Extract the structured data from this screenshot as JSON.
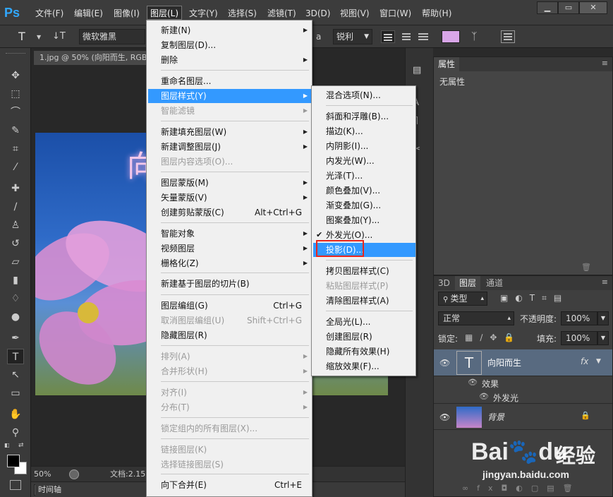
{
  "menubar": {
    "logo": "Ps",
    "items": [
      "文件(F)",
      "编辑(E)",
      "图像(I)",
      "图层(L)",
      "文字(Y)",
      "选择(S)",
      "滤镜(T)",
      "3D(D)",
      "视图(V)",
      "窗口(W)",
      "帮助(H)"
    ]
  },
  "window_controls": {
    "minimize": "▁",
    "restore": "▭",
    "close": "✕"
  },
  "options_bar": {
    "tool_glyph": "T",
    "font_name": "微软雅黑",
    "aa_label": "a",
    "antialias": "锐利",
    "swatch_color": "#d9a6e8"
  },
  "document": {
    "tab_title": "1.jpg @ 50% (向阳而生, RGB",
    "zoom": "50%",
    "doc_info": "文档:2.15",
    "canvas_text": "向"
  },
  "timeline_tab": "时间轴",
  "properties_panel": {
    "tab": "属性",
    "content": "无属性"
  },
  "layers_panel": {
    "tabs": [
      "3D",
      "图层",
      "通道"
    ],
    "filter": "类型",
    "blend_mode": "正常",
    "opacity_label": "不透明度:",
    "opacity": "100%",
    "lock_label": "锁定:",
    "fill_label": "填充:",
    "fill": "100%",
    "layers": [
      {
        "name": "向阳而生",
        "fx": "fx",
        "thumb": "T"
      },
      {
        "name": "背景"
      }
    ],
    "effects_label": "效果",
    "effect_item": "外发光"
  },
  "layer_menu": {
    "items": [
      {
        "label": "新建(N)",
        "arrow": "▶",
        "disabled": false
      },
      {
        "label": "复制图层(D)...",
        "disabled": false
      },
      {
        "label": "删除",
        "arrow": "▶",
        "disabled": false
      },
      {
        "label": "重命名图层...",
        "disabled": false
      },
      {
        "label": "图层样式(Y)",
        "arrow": "▶",
        "disabled": false,
        "highlight": true
      },
      {
        "label": "智能滤镜",
        "arrow": "▶",
        "disabled": true
      },
      {
        "label": "新建填充图层(W)",
        "arrow": "▶",
        "disabled": false
      },
      {
        "label": "新建调整图层(J)",
        "arrow": "▶",
        "disabled": false
      },
      {
        "label": "图层内容选项(O)...",
        "disabled": true
      },
      {
        "label": "图层蒙版(M)",
        "arrow": "▶",
        "disabled": false
      },
      {
        "label": "矢量蒙版(V)",
        "arrow": "▶",
        "disabled": false
      },
      {
        "label": "创建剪贴蒙版(C)",
        "shortcut": "Alt+Ctrl+G",
        "disabled": false
      },
      {
        "label": "智能对象",
        "arrow": "▶",
        "disabled": false
      },
      {
        "label": "视频图层",
        "arrow": "▶",
        "disabled": false
      },
      {
        "label": "栅格化(Z)",
        "arrow": "▶",
        "disabled": false
      },
      {
        "label": "新建基于图层的切片(B)",
        "disabled": false
      },
      {
        "label": "图层编组(G)",
        "shortcut": "Ctrl+G",
        "disabled": false
      },
      {
        "label": "取消图层编组(U)",
        "shortcut": "Shift+Ctrl+G",
        "disabled": true
      },
      {
        "label": "隐藏图层(R)",
        "disabled": false
      },
      {
        "label": "排列(A)",
        "arrow": "▶",
        "disabled": true
      },
      {
        "label": "合并形状(H)",
        "arrow": "▶",
        "disabled": true
      },
      {
        "label": "对齐(I)",
        "arrow": "▶",
        "disabled": true
      },
      {
        "label": "分布(T)",
        "arrow": "▶",
        "disabled": true
      },
      {
        "label": "锁定组内的所有图层(X)...",
        "disabled": true
      },
      {
        "label": "链接图层(K)",
        "disabled": true
      },
      {
        "label": "选择链接图层(S)",
        "disabled": true
      },
      {
        "label": "向下合并(E)",
        "shortcut": "Ctrl+E",
        "disabled": false
      }
    ]
  },
  "style_submenu": {
    "items": [
      {
        "label": "混合选项(N)...",
        "disabled": false
      },
      {
        "label": "斜面和浮雕(B)...",
        "disabled": false
      },
      {
        "label": "描边(K)...",
        "disabled": false
      },
      {
        "label": "内阴影(I)...",
        "disabled": false
      },
      {
        "label": "内发光(W)...",
        "disabled": false
      },
      {
        "label": "光泽(T)...",
        "disabled": false
      },
      {
        "label": "颜色叠加(V)...",
        "disabled": false
      },
      {
        "label": "渐变叠加(G)...",
        "disabled": false
      },
      {
        "label": "图案叠加(Y)...",
        "disabled": false
      },
      {
        "label": "外发光(O)...",
        "disabled": false,
        "checked": true
      },
      {
        "label": "投影(D)...",
        "disabled": false,
        "highlight": true
      },
      {
        "label": "拷贝图层样式(C)",
        "disabled": false
      },
      {
        "label": "粘贴图层样式(P)",
        "disabled": true
      },
      {
        "label": "清除图层样式(A)",
        "disabled": false
      },
      {
        "label": "全局光(L)...",
        "disabled": false
      },
      {
        "label": "创建图层(R)",
        "disabled": false
      },
      {
        "label": "隐藏所有效果(H)",
        "disabled": false
      },
      {
        "label": "缩放效果(F)...",
        "disabled": false
      }
    ]
  },
  "watermark": {
    "brand": "Bai",
    "brand2": "du",
    "cn": "经验",
    "url": "jingyan.baidu.com"
  },
  "colors": {
    "highlight": "#3399ff",
    "red_box": "#e8261c",
    "ps_blue": "#31a8ff"
  }
}
